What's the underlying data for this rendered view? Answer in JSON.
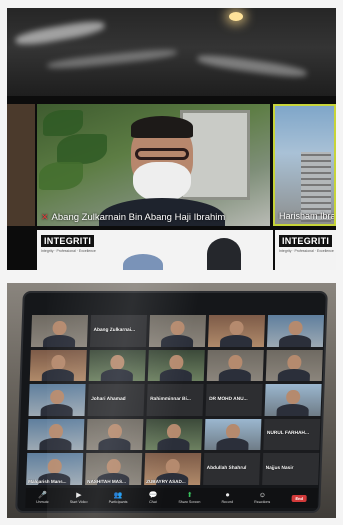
{
  "top_meeting": {
    "main_participant": "Abang Zulkarnain Bin Abang Haji Ibrahim",
    "side_participant": "Harisham Ibrah",
    "banner_brand": "INTEGRITI",
    "banner_tagline": "Integrity · Professional · Excellence",
    "status_colors": {
      "speaking_border": "#c7d43a",
      "mic_muted": "#e23b3b"
    }
  },
  "tablet_meeting": {
    "participants": [
      {
        "name": "",
        "style": "bg-b"
      },
      {
        "name": "Abang Zulkarnai...",
        "style": "name-only"
      },
      {
        "name": "",
        "style": "bg-b"
      },
      {
        "name": "",
        "style": "bg-e"
      },
      {
        "name": "",
        "style": "bg-a"
      },
      {
        "name": "",
        "style": "bg-e"
      },
      {
        "name": "",
        "style": "bg-c"
      },
      {
        "name": "",
        "style": "bg-c"
      },
      {
        "name": "",
        "style": "bg-b"
      },
      {
        "name": "",
        "style": "bg-b"
      },
      {
        "name": "",
        "style": "bg-a"
      },
      {
        "name": "Johari Ahamad",
        "style": "name-only"
      },
      {
        "name": "Rahimminnar Bi...",
        "style": "name-only"
      },
      {
        "name": "DR MOHD ANU...",
        "style": "name-only"
      },
      {
        "name": "",
        "style": "bg-d"
      },
      {
        "name": "",
        "style": "bg-a"
      },
      {
        "name": "",
        "style": "bg-b"
      },
      {
        "name": "",
        "style": "bg-c"
      },
      {
        "name": "",
        "style": "bg-d"
      },
      {
        "name": "NURUL FARHAH...",
        "style": "name-only"
      },
      {
        "name": "Malqarish Mans...",
        "style": "bg-a"
      },
      {
        "name": "NASHITAH MAS...",
        "style": "bg-b"
      },
      {
        "name": "ZUBAYRY ASAD...",
        "style": "bg-e"
      },
      {
        "name": "Abdullah Shahrul",
        "style": "name-only"
      },
      {
        "name": "Najjus Nasir",
        "style": "name-only"
      }
    ],
    "toolbar": [
      {
        "icon": "mic-icon",
        "glyph": "🎤",
        "label": "Unmute",
        "kind": "normal"
      },
      {
        "icon": "video-icon",
        "glyph": "▶",
        "label": "Start Video",
        "kind": "normal"
      },
      {
        "icon": "participants-icon",
        "glyph": "👥",
        "label": "Participants",
        "kind": "normal"
      },
      {
        "icon": "chat-icon",
        "glyph": "💬",
        "label": "Chat",
        "kind": "normal"
      },
      {
        "icon": "share-screen-icon",
        "glyph": "⬆",
        "label": "Share Screen",
        "kind": "share"
      },
      {
        "icon": "record-icon",
        "glyph": "⏺",
        "label": "Record",
        "kind": "normal"
      },
      {
        "icon": "reactions-icon",
        "glyph": "☺",
        "label": "Reactions",
        "kind": "normal"
      }
    ],
    "end_label": "End"
  }
}
